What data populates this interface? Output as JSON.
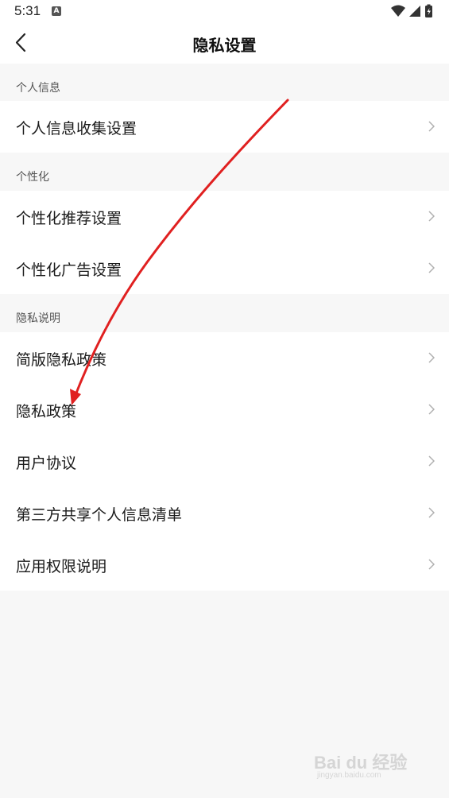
{
  "status_bar": {
    "time": "5:31",
    "notification_letter": "A",
    "icons": [
      "wifi-icon",
      "signal-icon",
      "battery-charging-icon"
    ]
  },
  "header": {
    "title": "隐私设置",
    "back_icon": "chevron-left-icon"
  },
  "sections": [
    {
      "title": "个人信息",
      "items": [
        "个人信息收集设置"
      ]
    },
    {
      "title": "个性化",
      "items": [
        "个性化推荐设置",
        "个性化广告设置"
      ]
    },
    {
      "title": "隐私说明",
      "items": [
        "简版隐私政策",
        "隐私政策",
        "用户协议",
        "第三方共享个人信息清单",
        "应用权限说明"
      ]
    }
  ],
  "watermark": {
    "main": "Bai du 经验",
    "sub": "jingyan.baidu.com"
  },
  "colors": {
    "background": "#f7f7f7",
    "row_background": "#ffffff",
    "annotation_arrow": "#e02020",
    "chevron": "#b0b0b0"
  }
}
